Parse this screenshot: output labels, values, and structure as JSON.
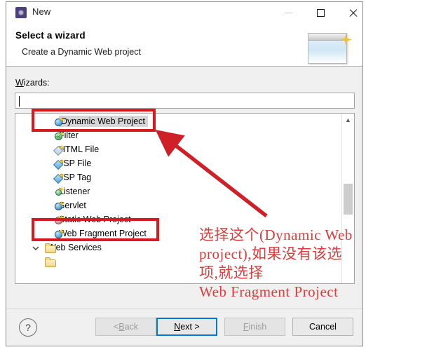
{
  "window": {
    "title": "New",
    "icon": "eclipse-gear-icon",
    "controls": {
      "minimize": "minimize-icon",
      "maximize": "maximize-icon",
      "close": "close-icon"
    }
  },
  "header": {
    "title": "Select a wizard",
    "description": "Create a Dynamic Web project",
    "banner_icon": "wizard-banner-icon"
  },
  "body": {
    "wizards_label_mnemonic": "W",
    "wizards_label_rest": "izards:",
    "filter_value": "",
    "filter_placeholder": "",
    "tree_items": [
      {
        "label": "Dynamic Web Project",
        "icon": "web-project-globe-icon",
        "selected": true,
        "type": "project"
      },
      {
        "label": "Filter",
        "icon": "filter-icon",
        "selected": false,
        "type": "filter"
      },
      {
        "label": "HTML File",
        "icon": "html-file-icon",
        "selected": false,
        "type": "html"
      },
      {
        "label": "JSP File",
        "icon": "jsp-file-icon",
        "selected": false,
        "type": "jsp"
      },
      {
        "label": "JSP Tag",
        "icon": "jsp-tag-icon",
        "selected": false,
        "type": "jsp"
      },
      {
        "label": "Listener",
        "icon": "listener-icon",
        "selected": false,
        "type": "listener"
      },
      {
        "label": "Servlet",
        "icon": "servlet-icon",
        "selected": false,
        "type": "servlet"
      },
      {
        "label": "Static Web Project",
        "icon": "static-web-project-icon",
        "selected": false,
        "type": "static"
      },
      {
        "label": "Web Fragment Project",
        "icon": "web-fragment-globe-icon",
        "selected": false,
        "type": "project"
      }
    ],
    "folder_item": {
      "label": "Web Services",
      "icon": "folder-icon",
      "expander": "chevron-down-icon"
    },
    "scrollbar": {
      "up_arrow": "scroll-up-icon"
    }
  },
  "footer": {
    "help": "?",
    "back": {
      "prefix": "< ",
      "mnemonic": "B",
      "rest": "ack",
      "enabled": false
    },
    "next": {
      "mnemonic": "N",
      "rest": "ext >",
      "enabled": true,
      "is_default": true
    },
    "finish": {
      "mnemonic": "F",
      "rest": "inish",
      "enabled": false
    },
    "cancel": {
      "label": "Cancel",
      "enabled": true
    }
  },
  "annotations": {
    "note_text": "选择这个(Dynamic Web\nproject),如果没有该选\n项,就选择\nWeb Fragment Project",
    "highlight_color": "#d71920",
    "note_color": "#e03a3a",
    "boxes": [
      {
        "name": "dynamic-web-project-highlight"
      },
      {
        "name": "web-fragment-project-highlight"
      }
    ],
    "arrow": {
      "name": "pointer-arrow",
      "from": "note",
      "to": "dynamic-web-project"
    }
  }
}
